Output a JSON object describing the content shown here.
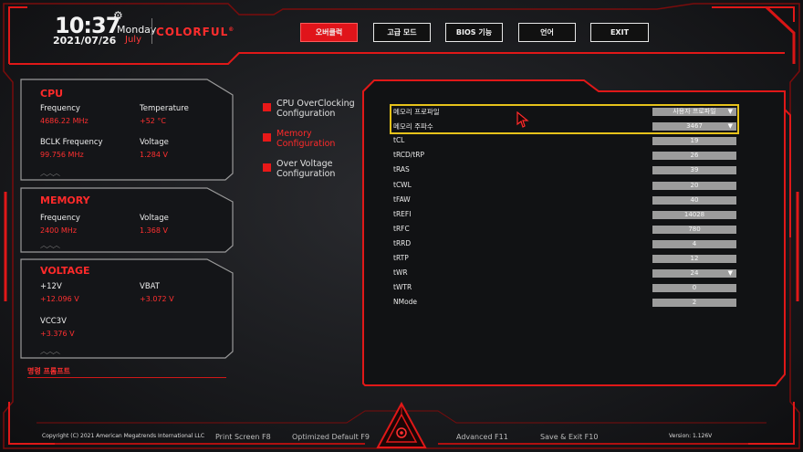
{
  "header": {
    "time": "10:37",
    "date": "2021/07/26",
    "weekday": "Monday",
    "month": "July",
    "brand": "COLORFUL",
    "brand_mark": "®"
  },
  "tabs": [
    {
      "label": "오버클럭",
      "active": true
    },
    {
      "label": "고급 모드",
      "active": false
    },
    {
      "label": "BIOS 기능",
      "active": false
    },
    {
      "label": "언어",
      "active": false
    },
    {
      "label": "EXIT",
      "active": false
    }
  ],
  "cpu": {
    "title": "CPU",
    "frequency_label": "Frequency",
    "frequency_value": "4686.22 MHz",
    "temperature_label": "Temperature",
    "temperature_value": "+52 °C",
    "bclk_label": "BCLK Frequency",
    "bclk_value": "99.756 MHz",
    "voltage_label": "Voltage",
    "voltage_value": "1.284 V"
  },
  "memory": {
    "title": "MEMORY",
    "frequency_label": "Frequency",
    "frequency_value": "2400 MHz",
    "voltage_label": "Voltage",
    "voltage_value": "1.368 V"
  },
  "voltage": {
    "title": "VOLTAGE",
    "v12_label": "+12V",
    "v12_value": "+12.096 V",
    "vbat_label": "VBAT",
    "vbat_value": "+3.072 V",
    "vcc3_label": "VCC3V",
    "vcc3_value": "+3.376 V"
  },
  "command_prompt": "명령 프롬프트",
  "menu": [
    {
      "line1": "CPU OverClocking",
      "line2": "Configuration",
      "active": false
    },
    {
      "line1": "Memory",
      "line2": "Configuration",
      "active": true
    },
    {
      "line1": "Over Voltage",
      "line2": "Configuration",
      "active": false
    }
  ],
  "settings": [
    {
      "label": "메모리 프로파일",
      "value": "사용자 프로파일",
      "dropdown": true
    },
    {
      "label": "메모리 주파수",
      "value": "3467",
      "dropdown": true
    },
    {
      "label": "tCL",
      "value": "19",
      "dropdown": false
    },
    {
      "label": "tRCD/tRP",
      "value": "26",
      "dropdown": false
    },
    {
      "label": "tRAS",
      "value": "39",
      "dropdown": false
    },
    {
      "label": "tCWL",
      "value": "20",
      "dropdown": false
    },
    {
      "label": "tFAW",
      "value": "40",
      "dropdown": false
    },
    {
      "label": "tREFI",
      "value": "14028",
      "dropdown": false
    },
    {
      "label": "tRFC",
      "value": "780",
      "dropdown": false
    },
    {
      "label": "tRRD",
      "value": "4",
      "dropdown": false
    },
    {
      "label": "tRTP",
      "value": "12",
      "dropdown": false
    },
    {
      "label": "tWR",
      "value": "24",
      "dropdown": true
    },
    {
      "label": "tWTR",
      "value": "0",
      "dropdown": false
    },
    {
      "label": "NMode",
      "value": "2",
      "dropdown": false
    }
  ],
  "footer": {
    "copyright": "Copyright (C) 2021 American Megatrends International LLC",
    "print_screen": "Print Screen F8",
    "optimized_default": "Optimized Default F9",
    "advanced": "Advanced F11",
    "save_exit": "Save & Exit F10",
    "version": "Version: 1.126V"
  },
  "colors": {
    "accent": "#e0141a",
    "highlight": "#e6c21a",
    "value_red": "#ff3030"
  },
  "icons": {
    "gear": "gear-icon",
    "arrow_down": "triangle-down-icon",
    "cursor": "mouse-pointer-icon",
    "emblem": "triangle-eye-emblem-icon"
  }
}
